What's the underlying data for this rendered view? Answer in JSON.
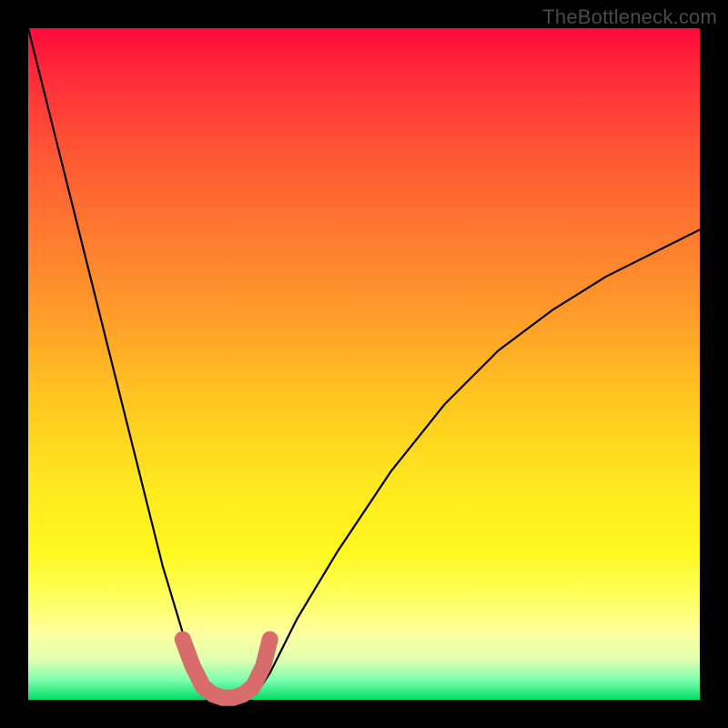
{
  "watermark": "TheBottleneck.com",
  "chart_data": {
    "type": "line",
    "title": "",
    "xlabel": "",
    "ylabel": "",
    "xlim": [
      0,
      100
    ],
    "ylim": [
      0,
      100
    ],
    "series": [
      {
        "name": "bottleneck-curve",
        "x": [
          0,
          4,
          8,
          12,
          16,
          20,
          23,
          25,
          27,
          29,
          30,
          32,
          34,
          36,
          40,
          46,
          54,
          62,
          70,
          78,
          86,
          94,
          100
        ],
        "values": [
          100,
          84,
          68,
          52,
          36,
          20,
          10,
          4,
          1,
          0,
          0,
          0,
          1,
          4,
          12,
          22,
          34,
          44,
          52,
          58,
          63,
          67,
          70
        ]
      }
    ],
    "highlight": {
      "name": "trough-marker",
      "color": "#d86b6b",
      "x": [
        23,
        24.5,
        26,
        27.5,
        29,
        30.5,
        32,
        33.5,
        35,
        36
      ],
      "values": [
        9,
        5,
        2,
        0.8,
        0.3,
        0.3,
        0.8,
        2,
        5,
        9
      ]
    }
  }
}
